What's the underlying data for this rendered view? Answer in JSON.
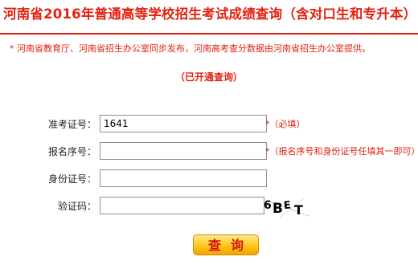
{
  "header": {
    "title": "河南省2016年普通高等学校招生考试成绩查询（含对口生和专升本）",
    "notice": "* 河南省教育厅、河南省招生办公室同步发布，河南高考查分数据由河南省招生办公室提供。",
    "status": "（已开通查询）"
  },
  "form": {
    "exam_number": {
      "label": "准考证号：",
      "value": "1641",
      "hint": "*（必填）"
    },
    "registration_number": {
      "label": "报名序号：",
      "value": "",
      "hint": "*（报名序号和身份证号任填其一即可）"
    },
    "id_number": {
      "label": "身份证号：",
      "value": ""
    },
    "captcha": {
      "label": "验证码：",
      "value": "",
      "image_text": "6BET"
    },
    "submit_label": "查询"
  },
  "colors": {
    "accent": "#e3210f",
    "button": "#ffc61a"
  }
}
